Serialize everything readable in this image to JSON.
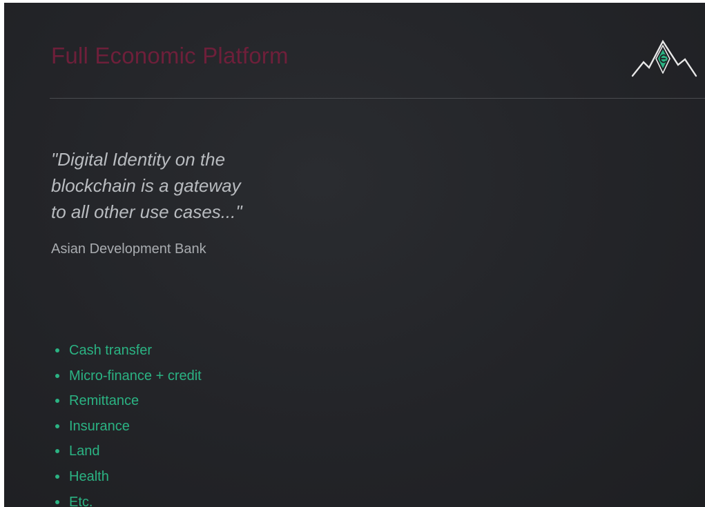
{
  "slide": {
    "title": "Full Economic Platform",
    "quote_lines": [
      "\"Digital Identity on the",
      "blockchain is a gateway",
      "to all other use cases...\""
    ],
    "attribution": "Asian Development Bank",
    "use_cases": [
      "Cash transfer",
      "Micro-finance + credit",
      "Remittance",
      "Insurance",
      "Land",
      "Health",
      "Etc."
    ],
    "logo_icon": "mountain-logo-icon"
  },
  "colors": {
    "background": "#232428",
    "title": "#6e1f3a",
    "quote_text": "#b9bcc0",
    "attribution_text": "#a9acb0",
    "accent_green": "#2bb383",
    "logo_stroke": "#e8e8e8",
    "divider": "#4a4c50"
  }
}
